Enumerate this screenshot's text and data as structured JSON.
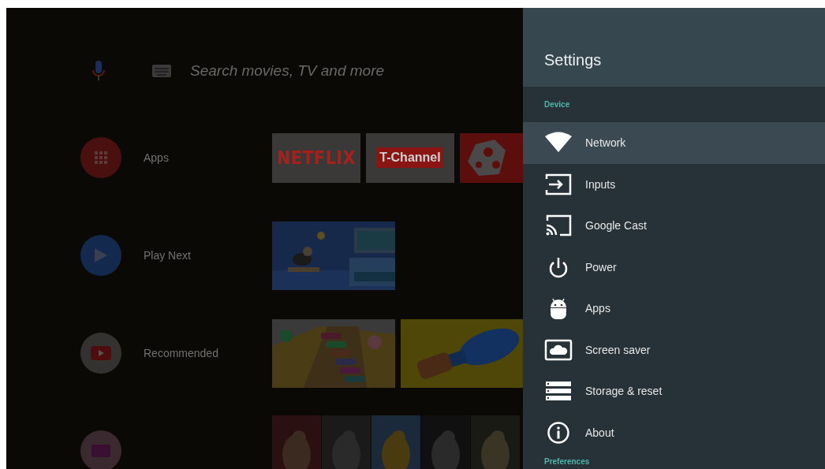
{
  "search": {
    "placeholder": "Search movies, TV and more"
  },
  "rows": [
    {
      "kind": "apps",
      "title": "Apps",
      "tiles": [
        {
          "kind": "logo",
          "label": "NETFLIX"
        },
        {
          "kind": "logo",
          "label": "T-Channel"
        },
        {
          "kind": "game"
        }
      ]
    },
    {
      "kind": "play_next",
      "title": "Play Next"
    },
    {
      "kind": "youtube",
      "title": "Recommended"
    },
    {
      "kind": "movies"
    }
  ],
  "settings": {
    "title": "Settings",
    "sections": [
      {
        "header": "Device",
        "items": [
          {
            "label": "Network",
            "selected": true
          },
          {
            "label": "Inputs",
            "selected": false
          },
          {
            "label": "Google Cast",
            "selected": false
          },
          {
            "label": "Power",
            "selected": false
          },
          {
            "label": "Apps",
            "selected": false
          },
          {
            "label": "Screen saver",
            "selected": false
          },
          {
            "label": "Storage & reset",
            "selected": false
          },
          {
            "label": "About",
            "selected": false
          }
        ]
      },
      {
        "header": "Preferences"
      }
    ]
  }
}
